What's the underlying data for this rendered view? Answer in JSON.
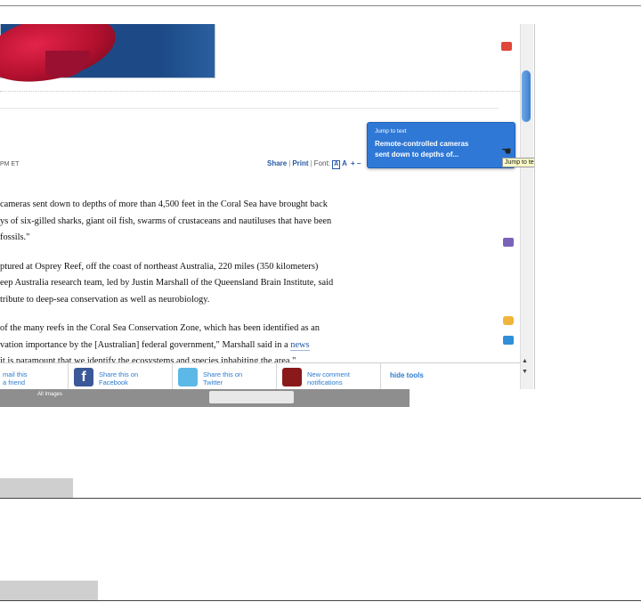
{
  "tooltip": {
    "heading": "Jump to text",
    "headline_line1": "Remote-controlled cameras",
    "headline_line2": "sent down to depths of..."
  },
  "hover_tip": "Jump to text",
  "article_meta": {
    "time_fragment": "PM ET"
  },
  "article_tools": {
    "share": "Share",
    "print": "Print",
    "font_label": "Font:",
    "font_a_boxed": "A",
    "font_a": "A",
    "plus": "+",
    "minus": "–"
  },
  "article": {
    "paragraphs": [
      [
        "cameras sent down to depths of more than 4,500 feet in the Coral Sea have brought back",
        "ys of six-gilled sharks, giant oil fish, swarms of crustaceans and nautiluses that have been",
        " fossils.\""
      ],
      [
        "ptured at Osprey Reef, off the coast of northeast Australia, 220 miles (350 kilometers)",
        "eep Australia research team, led by Justin Marshall of the Queensland Brain Institute, said",
        "tribute to deep-sea conservation as well as neurobiology."
      ],
      [
        " of the many reefs in the Coral Sea Conservation Zone, which has been identified as an",
        "vation importance by the [Australian] federal government,\" Marshall said in a ",
        "it is paramount that we identify the ecosystems and species inhabiting the area.\""
      ]
    ],
    "news_link": "news"
  },
  "bottom_bar": {
    "email_line1": "mail this",
    "email_line2": "a friend",
    "facebook_line1": "Share this on",
    "facebook_line2": "Facebook",
    "twitter_line1": "Share this on",
    "twitter_line2": "Twitter",
    "comment_line1": "New comment",
    "comment_line2": "notifications",
    "hide_tools": "hide tools"
  },
  "below_bar_label": "All Images",
  "icons": {
    "facebook": "facebook-icon",
    "twitter": "twitter-icon",
    "comment": "comment-notification-icon"
  },
  "colors": {
    "link_blue": "#2b7bd0",
    "tooltip_blue": "#2f78d6"
  }
}
